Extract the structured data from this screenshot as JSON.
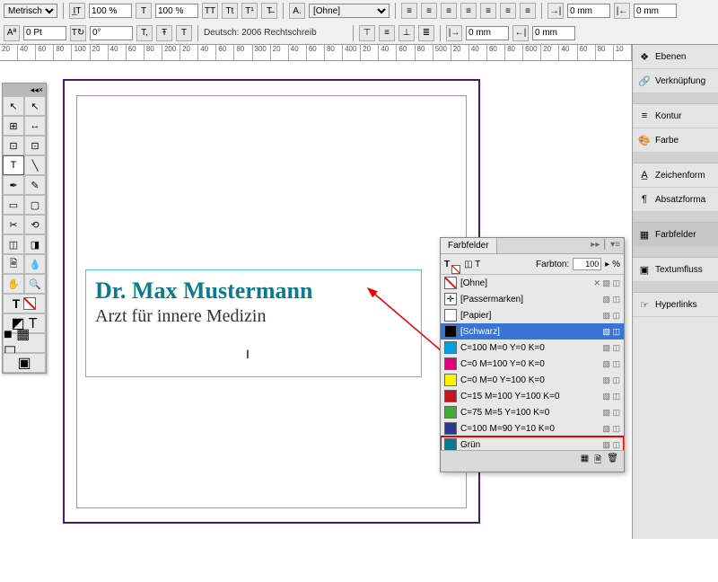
{
  "toolbar": {
    "units": "Metrisch",
    "scale1": "100 %",
    "scale2": "100 %",
    "leading": "0 Pt",
    "rotation": "0°",
    "style_none": "[Ohne]",
    "language": "Deutsch: 2006 Rechtschreib",
    "dim1": "0 mm",
    "dim2": "0 mm"
  },
  "ruler_ticks": [
    "20",
    "40",
    "60",
    "80",
    "100",
    "20",
    "40",
    "60",
    "80",
    "200",
    "20",
    "40",
    "60",
    "80",
    "300",
    "20",
    "40",
    "60",
    "80",
    "400",
    "20",
    "40",
    "60",
    "80",
    "500",
    "20",
    "40",
    "60",
    "80",
    "600",
    "20",
    "40",
    "60",
    "80",
    "10"
  ],
  "tools_header_close": "×",
  "canvas": {
    "headline": "Dr. Max Mustermann",
    "subline": "Arzt für innere Medizin"
  },
  "right_panel": {
    "items": [
      {
        "label": "Ebenen",
        "icon": "layers"
      },
      {
        "label": "Verknüpfung",
        "icon": "link"
      },
      {
        "label": "Kontur",
        "icon": "stroke"
      },
      {
        "label": "Farbe",
        "icon": "palette"
      },
      {
        "label": "Zeichenform",
        "icon": "char"
      },
      {
        "label": "Absatzforma",
        "icon": "para"
      },
      {
        "label": "Farbfelder",
        "icon": "swatches",
        "selected": true
      },
      {
        "label": "Textumfluss",
        "icon": "wrap"
      },
      {
        "label": "Hyperlinks",
        "icon": "hyperlink"
      }
    ]
  },
  "swatches": {
    "title": "Farbfelder",
    "tint_label": "Farbton:",
    "tint_value": "100",
    "tint_unit": "%",
    "rows": [
      {
        "name": "[Ohne]",
        "type": "none"
      },
      {
        "name": "[Passermarken]",
        "type": "registration"
      },
      {
        "name": "[Papier]",
        "color": "#ffffff"
      },
      {
        "name": "[Schwarz]",
        "color": "#000000",
        "selected": true
      },
      {
        "name": "C=100 M=0 Y=0 K=0",
        "color": "#00a0e3"
      },
      {
        "name": "C=0 M=100 Y=0 K=0",
        "color": "#e2007a"
      },
      {
        "name": "C=0 M=0 Y=100 K=0",
        "color": "#fff200"
      },
      {
        "name": "C=15 M=100 Y=100 K=0",
        "color": "#c4161c"
      },
      {
        "name": "C=75 M=5 Y=100 K=0",
        "color": "#3faa35"
      },
      {
        "name": "C=100 M=90 Y=10 K=0",
        "color": "#2a3890"
      },
      {
        "name": "Grün",
        "color": "#0a7b8c",
        "highlighted": true
      }
    ]
  }
}
